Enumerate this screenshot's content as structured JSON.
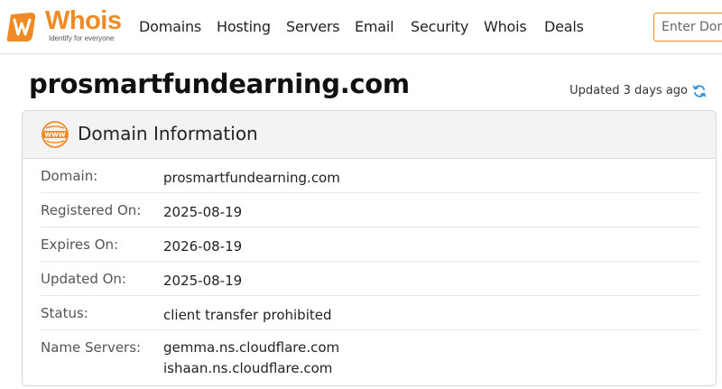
{
  "logo": {
    "name": "Whois",
    "tagline": "Identify for everyone",
    "brand_color": "#f08a24"
  },
  "nav": {
    "items": [
      {
        "label": "Domains"
      },
      {
        "label": "Hosting"
      },
      {
        "label": "Servers"
      },
      {
        "label": "Email"
      },
      {
        "label": "Security"
      },
      {
        "label": "Whois"
      },
      {
        "label": "Deals"
      }
    ],
    "search_placeholder": "Enter Domain"
  },
  "page": {
    "title": "prosmartfundearning.com",
    "updated_text": "Updated 3 days ago",
    "refresh_icon": "refresh-icon"
  },
  "card": {
    "icon": "www-icon",
    "title": "Domain Information",
    "rows": [
      {
        "label": "Domain:",
        "value": "prosmartfundearning.com"
      },
      {
        "label": "Registered On:",
        "value": "2025-08-19"
      },
      {
        "label": "Expires On:",
        "value": "2026-08-19"
      },
      {
        "label": "Updated On:",
        "value": "2025-08-19"
      },
      {
        "label": "Status:",
        "value": "client transfer prohibited"
      },
      {
        "label": "Name Servers:",
        "values": [
          "gemma.ns.cloudflare.com",
          "ishaan.ns.cloudflare.com"
        ]
      }
    ]
  }
}
